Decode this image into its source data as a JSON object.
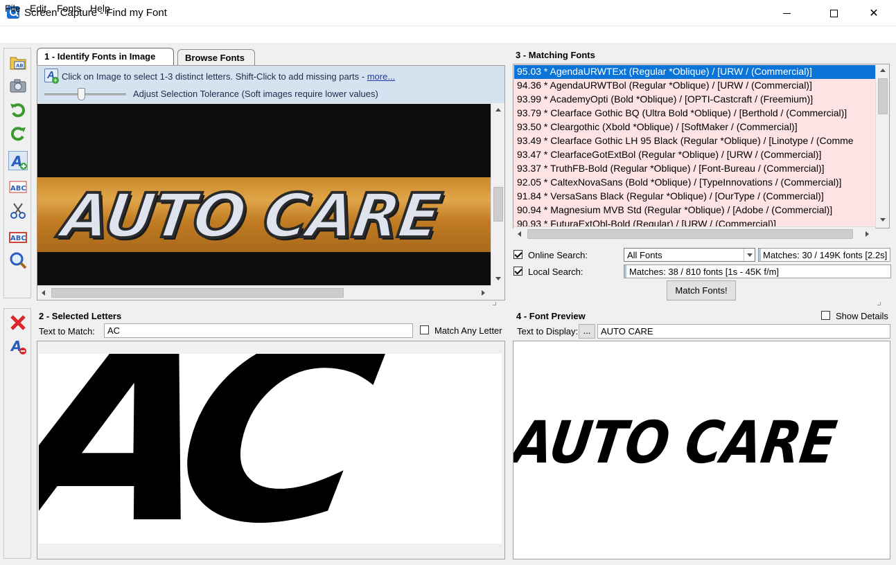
{
  "window": {
    "title": "Screen Capture - Find my Font",
    "close_glyph": "✕"
  },
  "menu": {
    "file": "File",
    "edit": "Edit",
    "fonts": "Fonts",
    "help": "Help"
  },
  "toolbar": {
    "tools": [
      "open-image-icon",
      "camera-icon",
      "rotate-left-icon",
      "rotate-right-icon",
      "add-letter-icon",
      "auto-letters-icon",
      "cut-icon",
      "auto-detect-icon",
      "zoom-icon"
    ],
    "bottom_tools": [
      "delete-icon",
      "remove-letter-icon"
    ]
  },
  "tabs": {
    "identify": "1 - Identify Fonts in Image",
    "browse": "Browse Fonts"
  },
  "identify": {
    "hint": "Click on Image to select 1-3 distinct letters. Shift-Click to add missing parts - ",
    "hint_link": "more...",
    "tolerance_label": "Adjust Selection Tolerance (Soft images require lower values)",
    "tolerance_level": 0.45,
    "image_text": "AUTO CARE"
  },
  "matching": {
    "title": "3 - Matching Fonts",
    "fonts": [
      "95.03 * AgendaURWTExt (Regular *Oblique) / [URW / (Commercial)]",
      "94.36 * AgendaURWTBol (Regular *Oblique) / [URW / (Commercial)]",
      "93.99 * AcademyOpti (Bold *Oblique) / [OPTI-Castcraft / (Freemium)]",
      "93.79 * Clearface Gothic BQ (Ultra Bold *Oblique) / [Berthold / (Commercial)]",
      "93.50 * Cleargothic (Xbold *Oblique) / [SoftMaker / (Commercial)]",
      "93.49 * Clearface Gothic LH 95 Black (Regular *Oblique) / [Linotype / (Comme",
      "93.47 * ClearfaceGotExtBol (Regular *Oblique) / [URW / (Commercial)]",
      "93.37 * TruthFB-Bold (Regular *Oblique) / [Font-Bureau / (Commercial)]",
      "92.05 * CaltexNovaSans (Bold *Oblique) / [TypeInnovations / (Commercial)]",
      "91.84 * VersaSans Black (Regular *Oblique) / [OurType / (Commercial)]",
      "90.94 * Magnesium MVB Std (Regular *Oblique) / [Adobe / (Commercial)]",
      "90.93 * FuturaExtObl-Bold (Regular) / [URW / (Commercial)]"
    ],
    "online_label": "Online Search:",
    "local_label": "Local Search:",
    "online_checked": true,
    "local_checked": true,
    "font_filter": "All Fonts",
    "online_status": "Matches: 30 / 149K fonts [2.2s]",
    "local_status": "Matches: 38 / 810 fonts [1s - 45K f/m]",
    "match_button": "Match Fonts!"
  },
  "selected": {
    "title": "2 - Selected Letters",
    "text_label": "Text to Match:",
    "text_value": "AC",
    "match_any_label": "Match Any Letter",
    "match_any_checked": false
  },
  "preview": {
    "title": "4 - Font Preview",
    "show_details_label": "Show Details",
    "show_details_checked": false,
    "display_label": "Text to Display:",
    "display_dots": "...",
    "display_value": "AUTO CARE"
  },
  "colors": {
    "selection": "#0a74d8",
    "list_bg": "#fde3e3",
    "hint_bg": "#d5e2f0"
  }
}
